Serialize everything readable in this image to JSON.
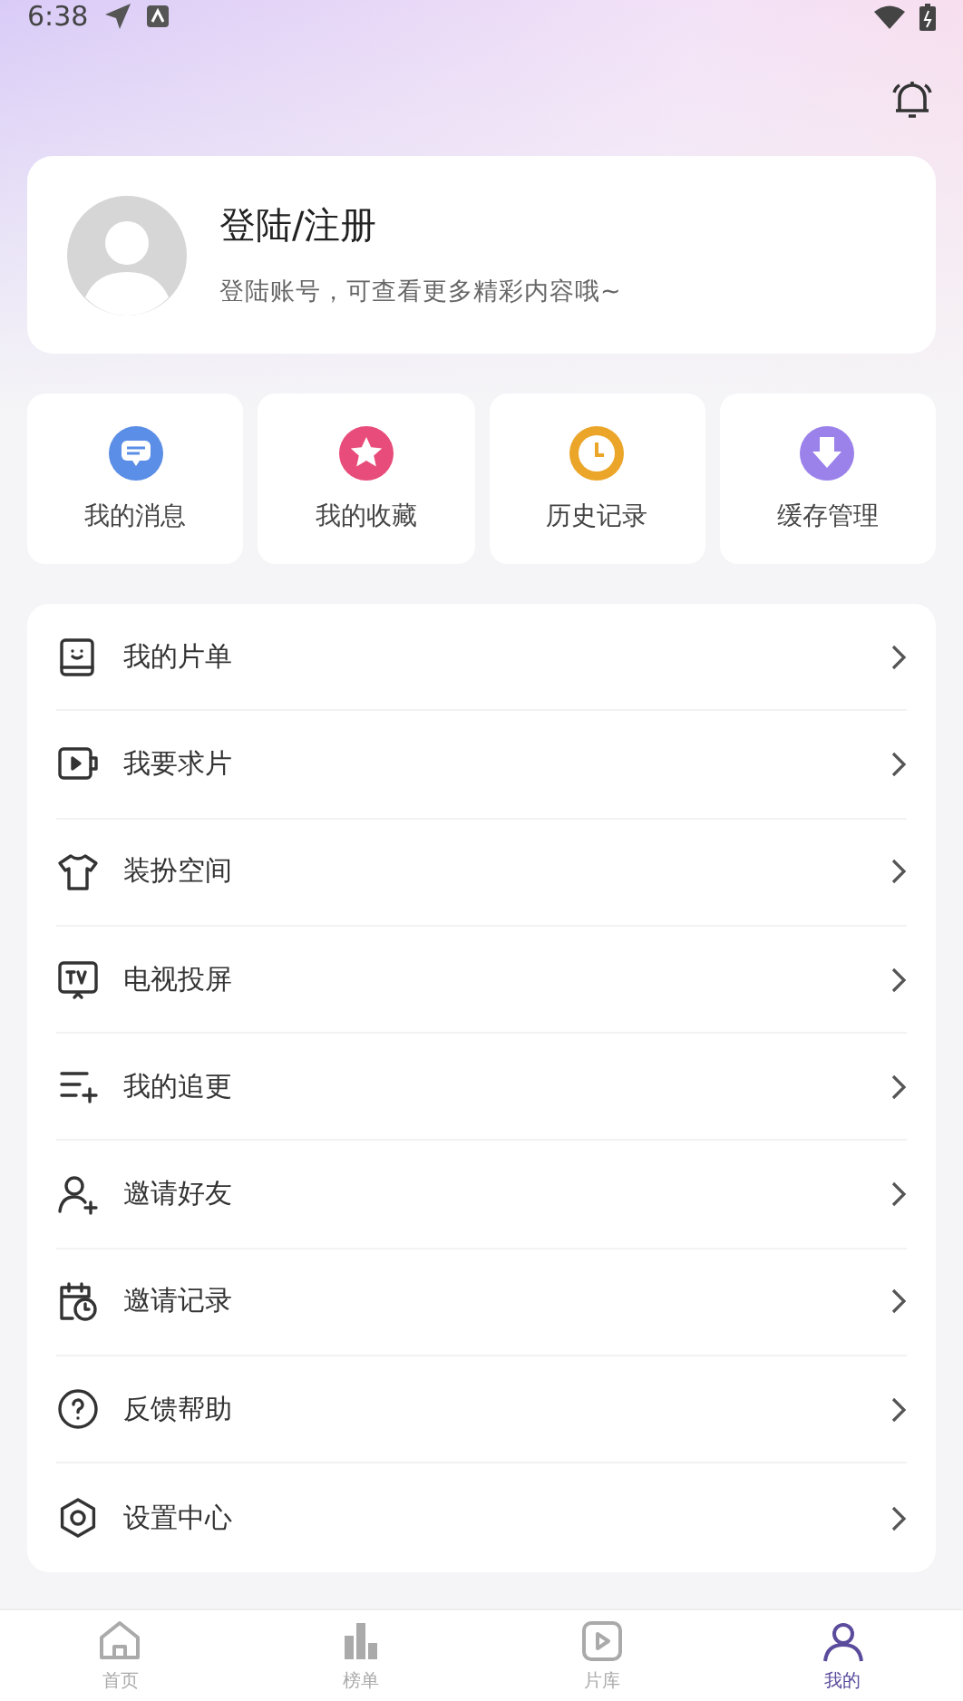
{
  "status_bar": {
    "time": "6:38"
  },
  "profile": {
    "title": "登陆/注册",
    "subtitle": "登陆账号，可查看更多精彩内容哦~"
  },
  "shortcuts": [
    {
      "label": "我的消息",
      "color": "#5b8ee6"
    },
    {
      "label": "我的收藏",
      "color": "#e84c7a"
    },
    {
      "label": "历史记录",
      "color": "#eba62a"
    },
    {
      "label": "缓存管理",
      "color": "#9a82ea"
    }
  ],
  "menu": [
    {
      "label": "我的片单"
    },
    {
      "label": "我要求片"
    },
    {
      "label": "装扮空间"
    },
    {
      "label": "电视投屏"
    },
    {
      "label": "我的追更"
    },
    {
      "label": "邀请好友"
    },
    {
      "label": "邀请记录"
    },
    {
      "label": "反馈帮助"
    },
    {
      "label": "设置中心"
    }
  ],
  "bottom_nav": [
    {
      "label": "首页",
      "selected": false
    },
    {
      "label": "榜单",
      "selected": false
    },
    {
      "label": "片库",
      "selected": false
    },
    {
      "label": "我的",
      "selected": true
    }
  ]
}
